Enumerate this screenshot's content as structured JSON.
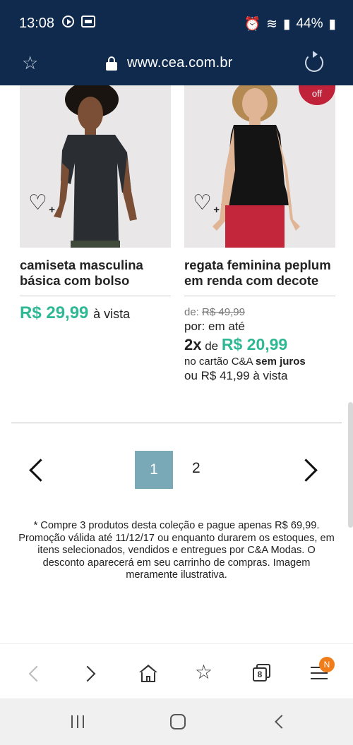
{
  "status_bar": {
    "time": "13:08",
    "battery": "44%"
  },
  "browser": {
    "url": "www.cea.com.br",
    "tabs_count": "8",
    "menu_badge": "N"
  },
  "products": [
    {
      "title_line1": "camiseta masculina",
      "title_line2": "básica com bolso",
      "price": "R$ 29,99",
      "price_suffix": "à vista"
    },
    {
      "badge": "off",
      "title_line1": "regata feminina peplum",
      "title_line2": "em renda com decote",
      "from_label": "de:",
      "old_price": "R$ 49,99",
      "por_label": "por: em até",
      "installments": "2x",
      "installment_de": "de",
      "installment_price": "R$ 20,99",
      "card_text": "no cartão C&A",
      "card_bold": "sem juros",
      "cash_text": "ou R$ 41,99 à vista"
    }
  ],
  "pagination": {
    "current": "1",
    "next_page": "2"
  },
  "disclaimer": "* Compre 3 produtos desta coleção e pague apenas R$ 69,99. Promoção válida até 11/12/17 ou enquanto durarem os estoques, em itens selecionados, vendidos e entregues por C&A Modas. O desconto aparecerá em seu carrinho de compras. Imagem meramente ilustrativa.",
  "colors": {
    "header_bg": "#0f2a4d",
    "price_green": "#2fb894",
    "page_active": "#79a9b7",
    "off_badge": "#c0223a"
  }
}
